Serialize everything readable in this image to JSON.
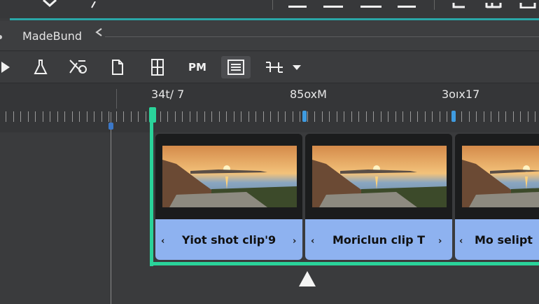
{
  "colors": {
    "accent": "#2aa7a8",
    "selection": "#2ad39a",
    "clip_label_bg": "#8eb2f0",
    "marker": "#3f9be0"
  },
  "breadcrumb": {
    "title": "MadeBund"
  },
  "toolbar": {
    "tools": [
      {
        "icon": "play-icon"
      },
      {
        "icon": "flask-icon"
      },
      {
        "icon": "scissors-icon"
      },
      {
        "icon": "page-icon"
      },
      {
        "icon": "split-panel-icon"
      },
      {
        "icon": "text-tool",
        "label": "PM"
      },
      {
        "icon": "list-icon"
      },
      {
        "icon": "trim-icon"
      },
      {
        "icon": "dropdown-caret-icon"
      }
    ]
  },
  "timeline": {
    "timecodes": [
      "34t/ 7",
      "85oxM",
      "3oıx17"
    ],
    "clips": [
      {
        "label": "Yiot shot clip'9"
      },
      {
        "label": "Moriclun clip T"
      },
      {
        "label": "Mo selipt"
      }
    ]
  }
}
